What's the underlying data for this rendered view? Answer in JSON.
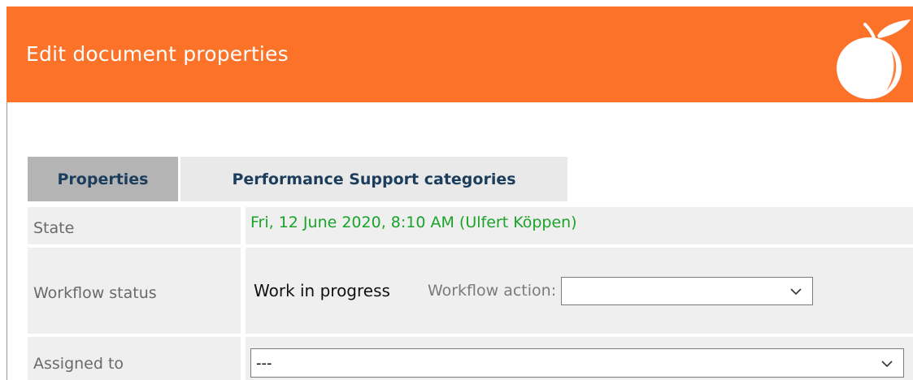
{
  "dialog": {
    "title": "Edit document properties",
    "header_color": "#fd7229",
    "logo_icon": "orange-fruit-icon"
  },
  "tabs": [
    {
      "label": "Properties",
      "active": true
    },
    {
      "label": "Performance Support categories",
      "active": false
    }
  ],
  "form": {
    "state": {
      "label": "State",
      "value": "Fri, 12 June 2020, 8:10 AM (Ulfert Köppen)",
      "value_color": "#1aa32a"
    },
    "workflow": {
      "label": "Workflow status",
      "status": "Work in progress",
      "action_label": "Workflow action:",
      "action_value": ""
    },
    "assigned": {
      "label": "Assigned to",
      "value": "---"
    }
  }
}
